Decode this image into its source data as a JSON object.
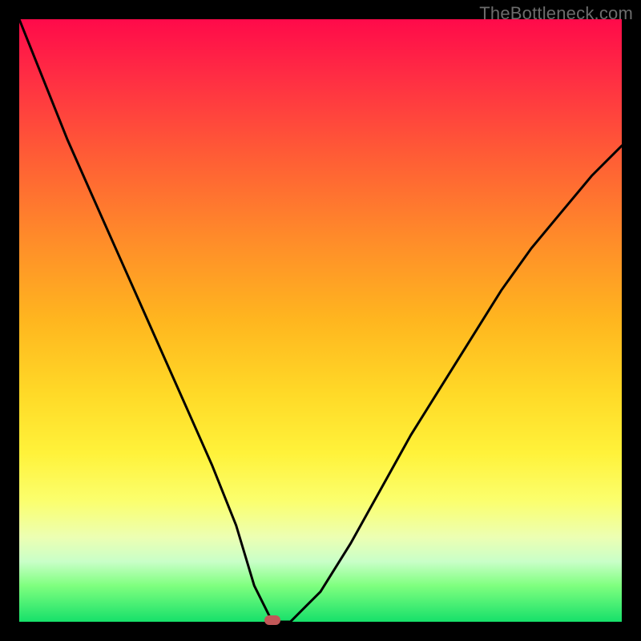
{
  "watermark": "TheBottleneck.com",
  "colors": {
    "frame": "#000000",
    "curve": "#000000",
    "marker": "#c25858",
    "gradient_top": "#ff0a4a",
    "gradient_bottom": "#16e06a"
  },
  "chart_data": {
    "type": "line",
    "title": "",
    "xlabel": "",
    "ylabel": "",
    "xlim": [
      0,
      1
    ],
    "ylim": [
      0,
      1
    ],
    "x": [
      0.0,
      0.04,
      0.08,
      0.12,
      0.16,
      0.2,
      0.24,
      0.28,
      0.32,
      0.36,
      0.39,
      0.42,
      0.45,
      0.5,
      0.55,
      0.6,
      0.65,
      0.7,
      0.75,
      0.8,
      0.85,
      0.9,
      0.95,
      1.0
    ],
    "values": [
      1.0,
      0.9,
      0.8,
      0.71,
      0.62,
      0.53,
      0.44,
      0.35,
      0.26,
      0.16,
      0.06,
      0.0,
      0.0,
      0.05,
      0.13,
      0.22,
      0.31,
      0.39,
      0.47,
      0.55,
      0.62,
      0.68,
      0.74,
      0.79
    ],
    "marker": {
      "x": 0.42,
      "y": 0.0
    },
    "grid": false,
    "legend": false
  }
}
